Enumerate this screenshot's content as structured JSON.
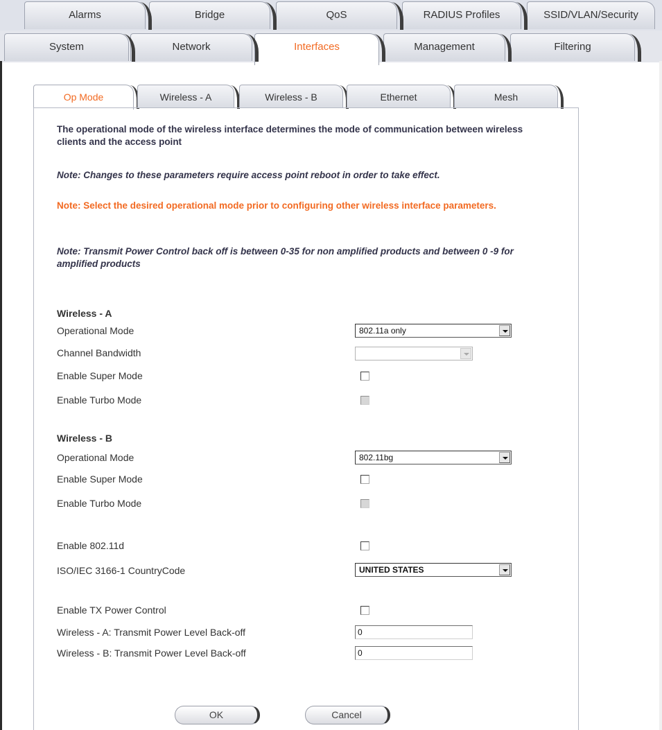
{
  "top_tabs_row1": [
    "Alarms",
    "Bridge",
    "QoS",
    "RADIUS Profiles",
    "SSID/VLAN/Security"
  ],
  "top_tabs_row2": [
    "System",
    "Network",
    "Interfaces",
    "Management",
    "Filtering"
  ],
  "active_top_tab": "Interfaces",
  "sub_tabs": [
    "Op Mode",
    "Wireless - A",
    "Wireless - B",
    "Ethernet",
    "Mesh"
  ],
  "active_sub_tab": "Op Mode",
  "description": "The operational mode of the wireless interface determines the mode of communication between wireless clients and the access point",
  "note_reboot": "Note: Changes to these parameters require access point reboot in order to take effect.",
  "note_select_mode": "Note: Select the desired operational mode prior to configuring other wireless interface parameters.",
  "note_tx_power": "Note: Transmit Power Control back off is between 0-35 for non amplified products and between 0 -9 for amplified products",
  "wireless_a": {
    "heading": "Wireless - A",
    "operational_mode_label": "Operational Mode",
    "operational_mode_value": "802.11a only",
    "channel_bandwidth_label": "Channel Bandwidth",
    "channel_bandwidth_value": "",
    "super_mode_label": "Enable Super Mode",
    "turbo_mode_label": "Enable Turbo Mode"
  },
  "wireless_b": {
    "heading": "Wireless - B",
    "operational_mode_label": "Operational Mode",
    "operational_mode_value": "802.11bg",
    "super_mode_label": "Enable Super Mode",
    "turbo_mode_label": "Enable Turbo Mode"
  },
  "general": {
    "enable_80211d_label": "Enable 802.11d",
    "country_code_label": "ISO/IEC 3166-1 CountryCode",
    "country_code_value": "UNITED STATES",
    "tx_power_control_label": "Enable TX Power Control",
    "tx_backoff_a_label": "Wireless - A: Transmit Power Level Back-off",
    "tx_backoff_a_value": "0",
    "tx_backoff_b_label": "Wireless - B: Transmit Power Level Back-off",
    "tx_backoff_b_value": "0"
  },
  "buttons": {
    "ok": "OK",
    "cancel": "Cancel"
  },
  "colors": {
    "accent_orange": "#f26a22",
    "tab_gray": "#d6d9e1",
    "text_dark": "#333333"
  }
}
